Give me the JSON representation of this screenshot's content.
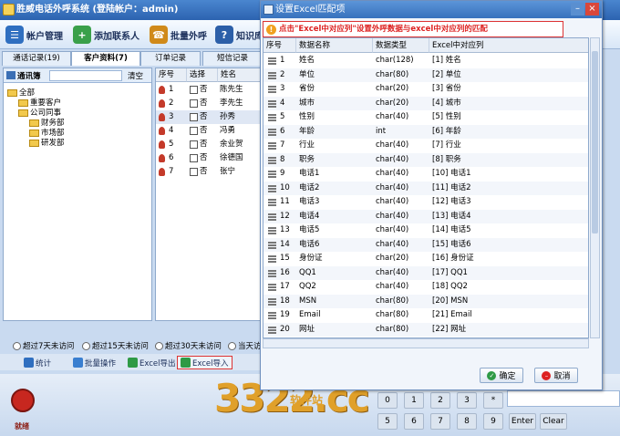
{
  "app": {
    "title": "胜威电话外呼系统 (登陆帐户：admin)"
  },
  "toolbar": [
    {
      "label": "帐户管理",
      "icon": "account-icon",
      "color": "#2f6fc0"
    },
    {
      "label": "添加联系人",
      "icon": "add-contact-icon",
      "color": "#3aa04a"
    },
    {
      "label": "批量外呼",
      "icon": "batch-call-icon",
      "color": "#d08a1a"
    },
    {
      "label": "知识库",
      "icon": "help-icon",
      "color": "#2c5fa8"
    }
  ],
  "tabs": [
    {
      "label": "通话记录(19)",
      "active": false
    },
    {
      "label": "客户资料(7)",
      "active": true
    },
    {
      "label": "订单记录",
      "active": false
    },
    {
      "label": "短信记录",
      "active": false
    }
  ],
  "left_panel": {
    "address_book_label": "通讯簿",
    "clear_button": "清空",
    "tree": [
      {
        "label": "全部",
        "level": 0
      },
      {
        "label": "重要客户",
        "level": 1
      },
      {
        "label": "公司同事",
        "level": 1
      },
      {
        "label": "财务部",
        "level": 2
      },
      {
        "label": "市场部",
        "level": 2
      },
      {
        "label": "研发部",
        "level": 2
      }
    ]
  },
  "customer_grid": {
    "headers": [
      "序号",
      "选择",
      "姓名"
    ],
    "rows": [
      {
        "no": "1",
        "select": "否",
        "name": "陈先生",
        "selected": false
      },
      {
        "no": "2",
        "select": "否",
        "name": "李先生",
        "selected": false
      },
      {
        "no": "3",
        "select": "否",
        "name": "孙秀",
        "selected": true
      },
      {
        "no": "4",
        "select": "否",
        "name": "冯勇",
        "selected": false
      },
      {
        "no": "5",
        "select": "否",
        "name": "余业贺",
        "selected": false
      },
      {
        "no": "6",
        "select": "否",
        "name": "徐德国",
        "selected": false
      },
      {
        "no": "7",
        "select": "否",
        "name": "张宁",
        "selected": false
      }
    ]
  },
  "filters": [
    "超过7天未访问",
    "超过15天未访问",
    "超过30天未访问",
    "当天访"
  ],
  "actions": [
    {
      "label": "统计",
      "color": "#2f6fc0"
    },
    {
      "label": "批量操作",
      "color": "#3a7fd0"
    },
    {
      "label": "Excel导出",
      "color": "#2f9a45"
    },
    {
      "label": "Excel导入",
      "color": "#2f9a45"
    }
  ],
  "status": {
    "phone_label": "就绪"
  },
  "keypad": {
    "row1": [
      "0",
      "1",
      "2",
      "3",
      "*"
    ],
    "row2": [
      "5",
      "6",
      "7",
      "8",
      "9",
      "#",
      "Enter",
      "Clear"
    ]
  },
  "watermark": {
    "text": "3322.cc",
    "sub": "软件站"
  },
  "dialog": {
    "title": "设置Excel匹配项",
    "notice": "点击\"Excel中对应列\"设置外呼数据与excel中对应列的匹配",
    "headers": [
      "序号",
      "数据名称",
      "数据类型",
      "Excel中对应列"
    ],
    "rows": [
      {
        "no": "1",
        "name": "姓名",
        "type": "char(128)",
        "col": "[1] 姓名"
      },
      {
        "no": "2",
        "name": "单位",
        "type": "char(80)",
        "col": "[2] 单位"
      },
      {
        "no": "3",
        "name": "省份",
        "type": "char(20)",
        "col": "[3] 省份"
      },
      {
        "no": "4",
        "name": "城市",
        "type": "char(20)",
        "col": "[4] 城市"
      },
      {
        "no": "5",
        "name": "性别",
        "type": "char(40)",
        "col": "[5] 性别"
      },
      {
        "no": "6",
        "name": "年龄",
        "type": "int",
        "col": "[6] 年龄"
      },
      {
        "no": "7",
        "name": "行业",
        "type": "char(40)",
        "col": "[7] 行业"
      },
      {
        "no": "8",
        "name": "职务",
        "type": "char(40)",
        "col": "[8] 职务"
      },
      {
        "no": "9",
        "name": "电话1",
        "type": "char(40)",
        "col": "[10] 电话1"
      },
      {
        "no": "10",
        "name": "电话2",
        "type": "char(40)",
        "col": "[11] 电话2"
      },
      {
        "no": "11",
        "name": "电话3",
        "type": "char(40)",
        "col": "[12] 电话3"
      },
      {
        "no": "12",
        "name": "电话4",
        "type": "char(40)",
        "col": "[13] 电话4"
      },
      {
        "no": "13",
        "name": "电话5",
        "type": "char(40)",
        "col": "[14] 电话5"
      },
      {
        "no": "14",
        "name": "电话6",
        "type": "char(40)",
        "col": "[15] 电话6"
      },
      {
        "no": "15",
        "name": "身份证",
        "type": "char(20)",
        "col": "[16] 身份证"
      },
      {
        "no": "16",
        "name": "QQ1",
        "type": "char(40)",
        "col": "[17] QQ1"
      },
      {
        "no": "17",
        "name": "QQ2",
        "type": "char(40)",
        "col": "[18] QQ2"
      },
      {
        "no": "18",
        "name": "MSN",
        "type": "char(80)",
        "col": "[20] MSN"
      },
      {
        "no": "19",
        "name": "Email",
        "type": "char(80)",
        "col": "[21] Email"
      },
      {
        "no": "20",
        "name": "网址",
        "type": "char(80)",
        "col": "[22] 网址"
      }
    ],
    "ok_button": "确定",
    "cancel_button": "取消"
  }
}
